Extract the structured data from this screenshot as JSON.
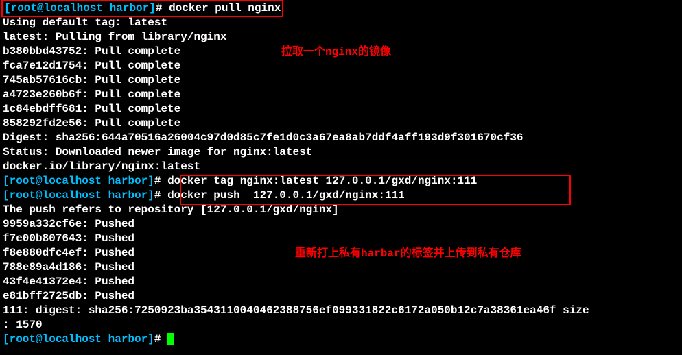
{
  "prompt": {
    "user_host": "[root@localhost",
    "dir": "harbor]",
    "hash": "#"
  },
  "cmd1": "docker pull nginx",
  "output1": [
    "Using default tag: latest",
    "latest: Pulling from library/nginx",
    "b380bbd43752: Pull complete ",
    "fca7e12d1754: Pull complete ",
    "745ab57616cb: Pull complete ",
    "a4723e260b6f: Pull complete ",
    "1c84ebdff681: Pull complete ",
    "858292fd2e56: Pull complete ",
    "Digest: sha256:644a70516a26004c97d0d85c7fe1d0c3a67ea8ab7ddf4aff193d9f301670cf36",
    "Status: Downloaded newer image for nginx:latest",
    "docker.io/library/nginx:latest"
  ],
  "cmd2": "docker tag nginx:latest 127.0.0.1/gxd/nginx:111",
  "cmd3": "docker push  127.0.0.1/gxd/nginx:111",
  "output2": [
    "The push refers to repository [127.0.0.1/gxd/nginx]",
    "9959a332cf6e: Pushed ",
    "f7e00b807643: Pushed ",
    "f8e880dfc4ef: Pushed ",
    "788e89a4d186: Pushed ",
    "43f4e41372e4: Pushed ",
    "e81bff2725db: Pushed ",
    "111: digest: sha256:7250923ba354311004046238875​6ef099331822c6172a050b12c7a38361ea46f size",
    ": 1570"
  ],
  "annotation1": "拉取一个nginx的镜像",
  "annotation2": "重新打上私有harbar的标签并上传到私有仓库"
}
